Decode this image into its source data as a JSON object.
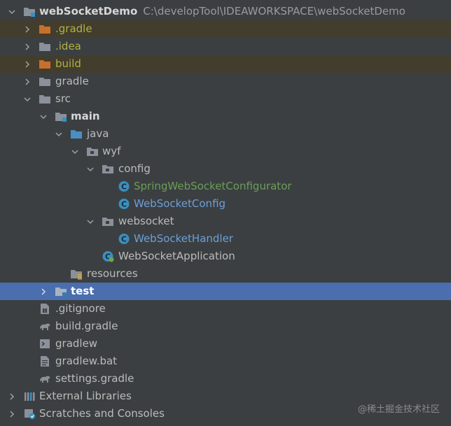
{
  "tree": {
    "root": {
      "name": "webSocketDemo",
      "path": "C:\\developTool\\IDEAWORKSPACE\\webSocketDemo"
    },
    "gradle_hidden": ".gradle",
    "idea": ".idea",
    "build": "build",
    "gradle": "gradle",
    "src": "src",
    "main": "main",
    "java": "java",
    "wyf": "wyf",
    "config": "config",
    "spring_configurator": "SpringWebSocketConfigurator",
    "websocket_config": "WebSocketConfig",
    "websocket_pkg": "websocket",
    "websocket_handler": "WebSocketHandler",
    "websocket_application": "WebSocketApplication",
    "resources": "resources",
    "test": "test",
    "gitignore": ".gitignore",
    "build_gradle": "build.gradle",
    "gradlew": "gradlew",
    "gradlew_bat": "gradlew.bat",
    "settings_gradle": "settings.gradle",
    "external_libraries": "External Libraries",
    "scratches": "Scratches and Consoles"
  },
  "watermark": "@稀土掘金技术社区",
  "colors": {
    "background": "#3c3f41",
    "selection": "#4b6eaf",
    "excluded_dir_bg": "#433d2d",
    "excluded_text": "#b0b245",
    "spring_class_text": "#6a9e58",
    "class_text": "#6c9fd8"
  }
}
